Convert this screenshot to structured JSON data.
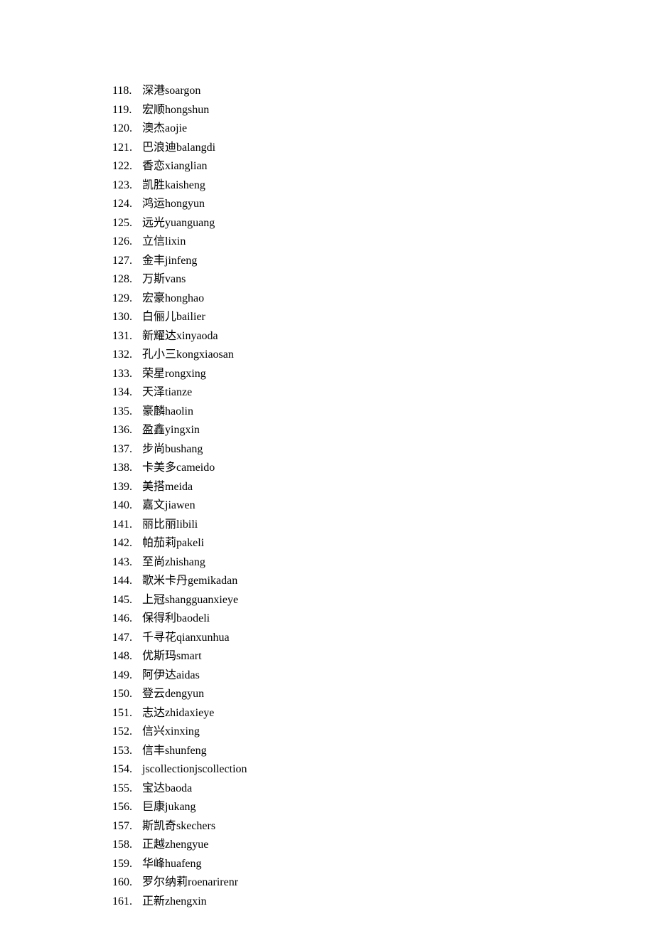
{
  "start_number": 118,
  "items": [
    "深港soargon",
    "宏顺hongshun",
    "澳杰aojie",
    "巴浪迪balangdi",
    "香恋xianglian",
    "凯胜kaisheng",
    "鸿运hongyun",
    "远光yuanguang",
    "立信lixin",
    "金丰jinfeng",
    "万斯vans",
    "宏豪honghao",
    "白俪儿bailier",
    "新耀达xinyaoda",
    "孔小三kongxiaosan",
    "荣星rongxing",
    "天泽tianze",
    "豪麟haolin",
    "盈鑫yingxin",
    "步尚bushang",
    "卡美多cameido",
    "美搭meida",
    "嘉文jiawen",
    "丽比丽libili",
    "帕茄莉pakeli",
    "至尚zhishang",
    "歌米卡丹gemikadan",
    "上冠shangguanxieye",
    "保得利baodeli",
    "千寻花qianxunhua",
    "优斯玛smart",
    "阿伊达aidas",
    "登云dengyun",
    "志达zhidaxieye",
    "信兴xinxing",
    "信丰shunfeng",
    "jscollectionjscollection",
    "宝达baoda",
    "巨康jukang",
    "斯凯奇skechers",
    "正越zhengyue",
    "华峰huafeng",
    "罗尔纳莉roenarirenr",
    "正新zhengxin"
  ]
}
